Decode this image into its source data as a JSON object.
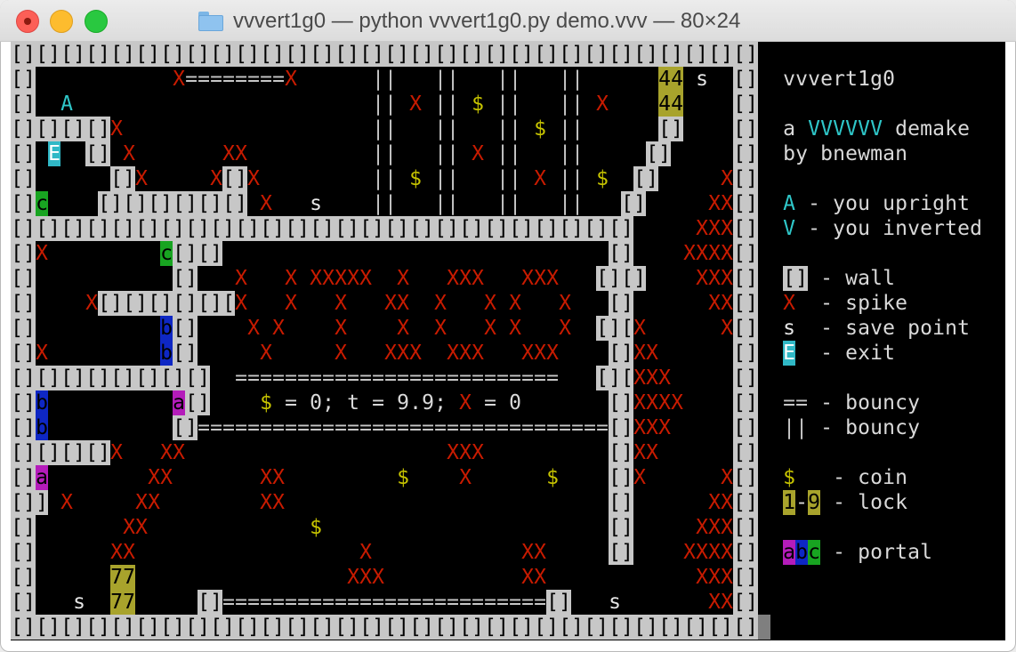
{
  "window": {
    "title": "vvvert1g0 — python vvvert1g0.py demo.vvv — 80×24"
  },
  "icons": {
    "close": "close-icon",
    "minimize": "minimize-icon",
    "maximize": "maximize-icon",
    "folder": "folder-icon"
  },
  "colors": {
    "wall": "#c7c7c7",
    "spike": "#c91b00",
    "coin": "#c7c400",
    "lock": "#a8a32c",
    "portal_a": "#b41cba",
    "portal_b": "#0e27c4",
    "portal_c": "#18a421",
    "exit": "#30b8c6",
    "player": "#2fc7c9",
    "background": "#000000"
  },
  "terminal": {
    "rows": [
      "[][][][][][][][][][][][][][][][][][][][][][][][][][][][][][]",
      "[]          X========X           ||    ||    ||    ||      44 s  []  vvvert1g0",
      "[]  A                            || X  || $  ||    || X    44     []",
      "[][][][]X                        ||    ||    || $  ||      []     []  a VVVVVV demake",
      "[] E [][]X                        ||    || X  ||    ||     []      []  by bnewman",
      "[]     []X      X[]X             || $  ||    || X  || $  []     X[]",
      "[]c     [][][][][][]X     s      ||    ||    ||    ||   []    XX[]  A - you upright",
      "[][][][][][][][][][][][][][][][][][][][][][][][][][][][][]    XXX[]  V - you inverted",
      "[]X          c[][]                                       []    XXXX[]",
      "[]             []   X   X XXXXX   X    XXX    XXX       [][]    XXX[]  [] - wall",
      "[]     X[][][][][][]   X   X    X    XX  X    X X    X    []     XX[]  X  - spike",
      "[]           b[]    X X    X     X   X    X X    X     [][]X     X[]  s  - save point",
      "[]X          b[]     X     X   XXX  XXX    XXX         []XX       []  E  - exit",
      "[][][][][][][][]   ==========================         [][]XXX     []",
      "[]b          a[]     $ = 0; t = 9.9; X = 0             []XXXX     []  == - bouncy",
      "[]b           []=================================      []XXX      []  || - bouncy",
      "[][][][]X    XX                   XXX                 []XX       []",
      "[]a         XX       XX         $     X         $     []X       X[]  $   - coin",
      "[][]X       XX        XX                              []       XX[]  1-9 - lock",
      "[]         XX              $                          []      XXX[]",
      "[]       XX                    X           XX         []     XXXX[]  abc - portal",
      "[]       77                   XXX          XX                 XXX[]",
      "[]    s  77      []==========================[]      s         XX[]",
      "[][][][][][][][][][][][][][][][][][][][][][][][][][][][][][][][][][][][][][][][]"
    ]
  },
  "legend": {
    "title": "vvvert1g0",
    "line1_pre": "a ",
    "line1_hl": "VVVVVV",
    "line1_post": " demake",
    "line2": "by bnewman",
    "upright_sym": "A",
    "upright_text": " - you upright",
    "inverted_sym": "V",
    "inverted_text": " - you inverted",
    "wall_sym": "[]",
    "wall_text": " - wall",
    "spike_sym": "X",
    "spike_text": "  - spike",
    "save_sym": "s",
    "save_text": "  - save point",
    "exit_sym": "E",
    "exit_text": "  - exit",
    "bouncy_h_sym": "==",
    "bouncy_h_text": " - bouncy",
    "bouncy_v_sym": "||",
    "bouncy_v_text": " - bouncy",
    "coin_sym": "$",
    "coin_text": "   - coin",
    "lock_sym1": "1",
    "lock_dash": "-",
    "lock_sym2": "9",
    "lock_text": " - lock",
    "portal_a": "a",
    "portal_b": "b",
    "portal_c": "c",
    "portal_text": " - portal"
  },
  "status": {
    "coins_label": "$",
    "coins_text": " = 0; t = 9.9; ",
    "spike_label": "X",
    "spike_text": " = 0"
  }
}
